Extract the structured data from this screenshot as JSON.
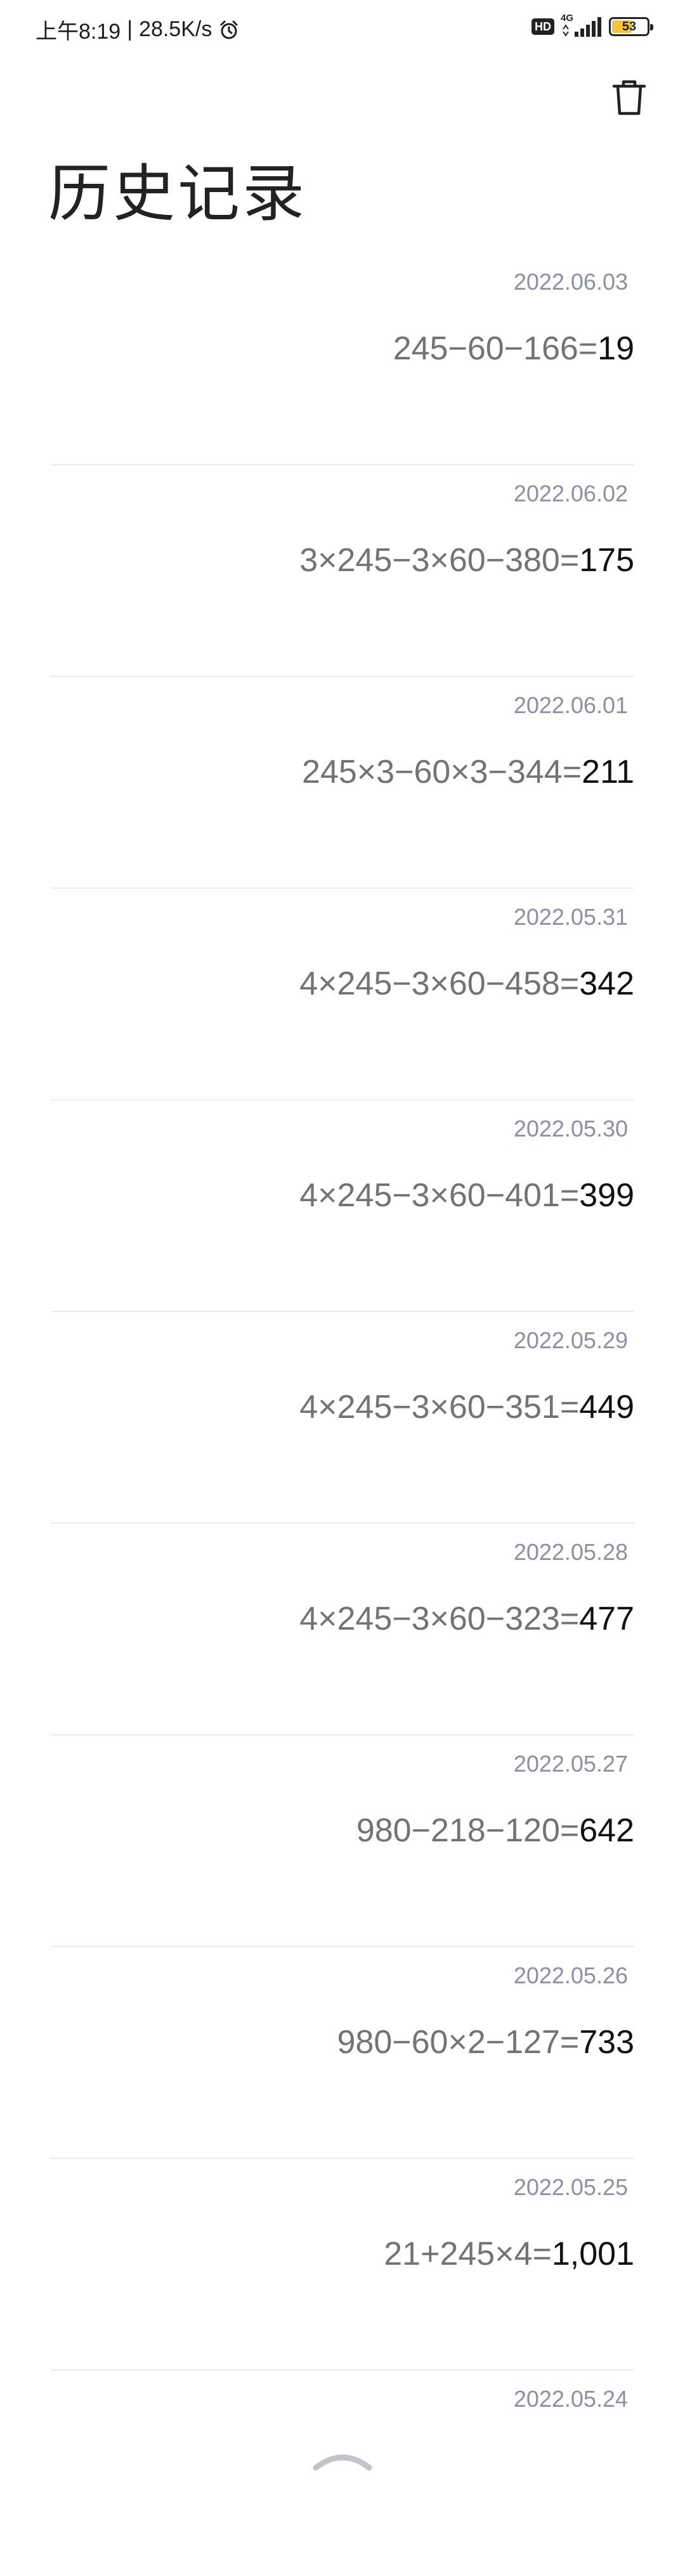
{
  "status_bar": {
    "time": "上午8:19",
    "separator": "|",
    "speed": "28.5K/s",
    "alarm_icon": "alarm-clock-icon",
    "hd_label": "HD",
    "network_type": "4G",
    "signal_icon": "signal-bars-icon",
    "battery_level": "53",
    "battery_color": "#f3c53b"
  },
  "toolbar": {
    "delete_icon": "trash-icon"
  },
  "page": {
    "title": "历史记录"
  },
  "history": [
    {
      "date": "2022.06.03",
      "expression": "245−60−166=",
      "result": "19"
    },
    {
      "date": "2022.06.02",
      "expression": "3×245−3×60−380=",
      "result": "175"
    },
    {
      "date": "2022.06.01",
      "expression": "245×3−60×3−344=",
      "result": "211"
    },
    {
      "date": "2022.05.31",
      "expression": "4×245−3×60−458=",
      "result": "342"
    },
    {
      "date": "2022.05.30",
      "expression": "4×245−3×60−401=",
      "result": "399"
    },
    {
      "date": "2022.05.29",
      "expression": "4×245−3×60−351=",
      "result": "449"
    },
    {
      "date": "2022.05.28",
      "expression": "4×245−3×60−323=",
      "result": "477"
    },
    {
      "date": "2022.05.27",
      "expression": "980−218−120=",
      "result": "642"
    },
    {
      "date": "2022.05.26",
      "expression": "980−60×2−127=",
      "result": "733"
    },
    {
      "date": "2022.05.25",
      "expression": "21+245×4=",
      "result": "1,001"
    },
    {
      "date": "2022.05.24",
      "expression": "",
      "result": ""
    }
  ],
  "footer": {
    "collapse_icon": "chevron-up-icon"
  },
  "colors": {
    "date_text": "#8d8fa3",
    "expression_text": "#737373",
    "result_text": "#111111",
    "divider": "#ececec"
  }
}
